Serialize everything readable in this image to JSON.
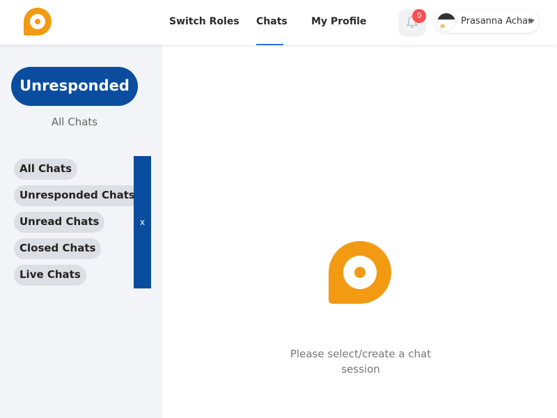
{
  "header": {
    "nav": [
      {
        "label": "Switch Roles"
      },
      {
        "label": "Chats"
      },
      {
        "label": "My Profile"
      }
    ],
    "active_nav": "Chats",
    "notifications": {
      "count": "0"
    },
    "user": {
      "name": "Prasanna Achar",
      "avatar_mark": "ılılı"
    }
  },
  "sidebar": {
    "primary_button": "Unresponded",
    "current_filter_label": "All Chats",
    "filters": [
      {
        "label": "All Chats"
      },
      {
        "label": "Unresponded Chats"
      },
      {
        "label": "Unread Chats"
      },
      {
        "label": "Closed Chats"
      },
      {
        "label": "Live Chats"
      }
    ],
    "close_label": "x"
  },
  "main": {
    "empty_message": "Please select/create a chat session"
  },
  "colors": {
    "brand_orange": "#f29a12",
    "primary_blue": "#0a4d9e",
    "active_underline": "#2c6fe0",
    "badge_red": "#ff4d4f"
  },
  "icons": {
    "logo": "chat-bubble-logo-icon",
    "notifications": "bell-icon",
    "dropdown": "caret-down-icon"
  }
}
